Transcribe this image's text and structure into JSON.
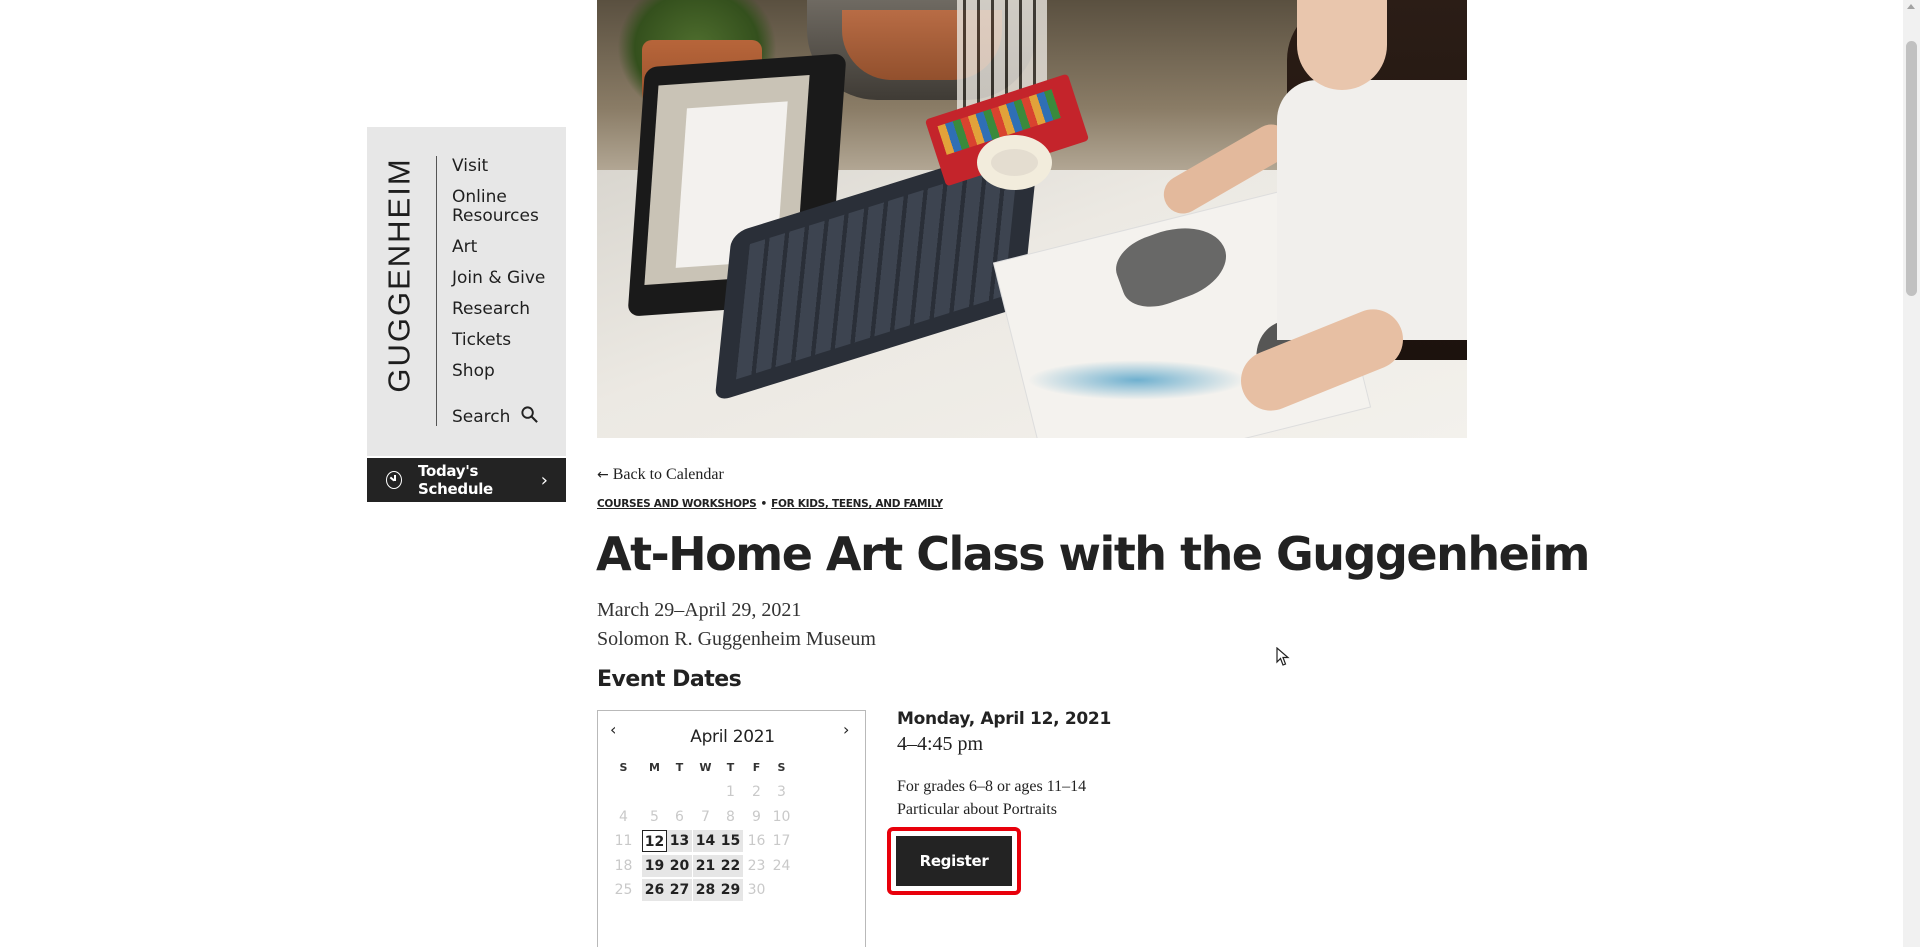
{
  "nav": {
    "wordmark": "GUGGENHEIM",
    "items": [
      "Visit",
      "Online Resources",
      "Art",
      "Join & Give",
      "Research",
      "Tickets",
      "Shop"
    ],
    "search_label": "Search",
    "schedule_label": "Today's Schedule"
  },
  "event": {
    "back_link": "Back to Calendar",
    "categories": [
      "COURSES AND WORKSHOPS",
      "FOR KIDS, TEENS, AND FAMILY"
    ],
    "category_separator": "•",
    "title": "At-Home Art Class with the Guggenheim",
    "date_range": "March 29–April 29, 2021",
    "location": "Solomon R. Guggenheim Museum",
    "event_dates_heading": "Event Dates"
  },
  "calendar": {
    "month_label": "April 2021",
    "prev_icon": "chevron-left-icon",
    "next_icon": "chevron-right-icon",
    "weekdays": [
      "S",
      "M",
      "T",
      "W",
      "T",
      "F",
      "S"
    ],
    "weeks": [
      [
        null,
        null,
        null,
        null,
        "1",
        "2",
        "3"
      ],
      [
        "4",
        "5",
        "6",
        "7",
        "8",
        "9",
        "10"
      ],
      [
        "11",
        "12",
        "13",
        "14",
        "15",
        "16",
        "17"
      ],
      [
        "18",
        "19",
        "20",
        "21",
        "22",
        "23",
        "24"
      ],
      [
        "25",
        "26",
        "27",
        "28",
        "29",
        "30",
        null
      ]
    ],
    "available_days": [
      "12",
      "13",
      "14",
      "15",
      "19",
      "20",
      "21",
      "22",
      "26",
      "27",
      "28",
      "29"
    ],
    "selected_day": "12"
  },
  "session": {
    "date": "Monday, April 12, 2021",
    "time": "4–4:45 pm",
    "grades": "For grades 6–8 or ages 11–14",
    "topic": "Particular about Portraits",
    "register_label": "Register"
  },
  "colors": {
    "nav_background": "#e7e7e7",
    "dark_button": "#232323",
    "highlight_outline": "#e8000b",
    "available_day_bg": "#e6e6e6"
  }
}
